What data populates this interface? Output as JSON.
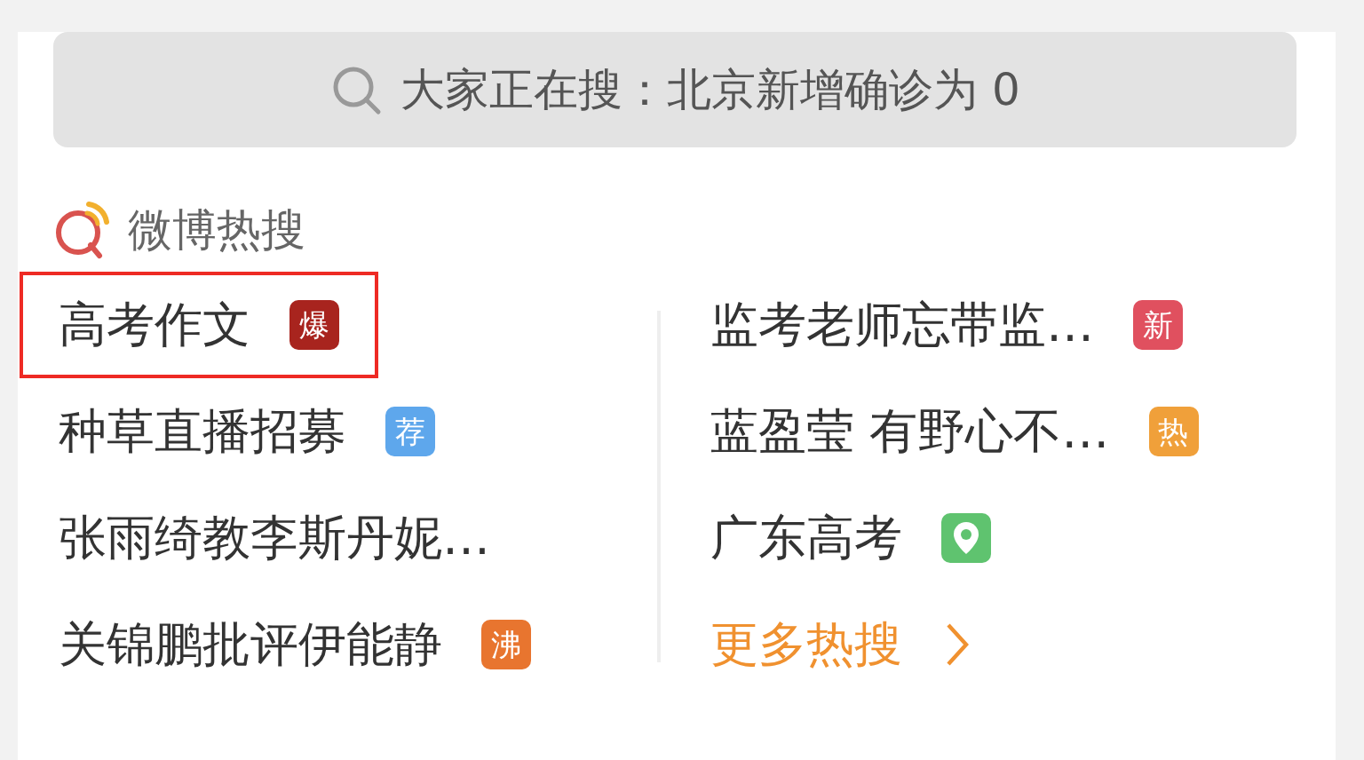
{
  "search_bar": {
    "placeholder": "大家正在搜：北京新增确诊为 0"
  },
  "hot_search": {
    "title": "微博热搜",
    "left_column": [
      {
        "title": "高考作文",
        "highlighted": true,
        "badge": {
          "kind": "text",
          "text": "爆",
          "color": "#a8241e"
        }
      },
      {
        "title": "种草直播招募",
        "highlighted": false,
        "badge": {
          "kind": "text",
          "text": "荐",
          "color": "#5ea7ec"
        }
      },
      {
        "title": "张雨绮教李斯丹妮…",
        "highlighted": false
      },
      {
        "title": "关锦鹏批评伊能静",
        "highlighted": false,
        "badge": {
          "kind": "text",
          "text": "沸",
          "color": "#e8752f"
        }
      }
    ],
    "right_column": [
      {
        "title": "监考老师忘带监…",
        "highlighted": false,
        "badge": {
          "kind": "text",
          "text": "新",
          "color": "#e0505f"
        }
      },
      {
        "title": "蓝盈莹 有野心不…",
        "highlighted": false,
        "badge": {
          "kind": "text",
          "text": "热",
          "color": "#f0a03a"
        }
      },
      {
        "title": "广东高考",
        "highlighted": false,
        "badge": {
          "kind": "pin",
          "color": "#5fc36f"
        }
      }
    ],
    "more_link": {
      "label": "更多热搜"
    }
  }
}
